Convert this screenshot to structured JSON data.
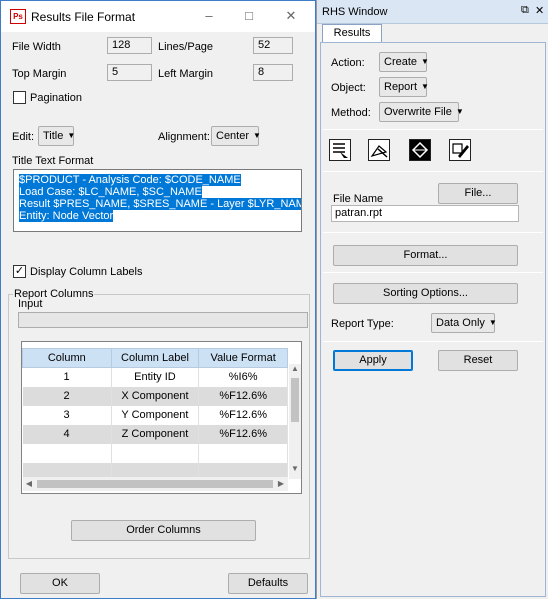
{
  "dialog": {
    "title": "Results File Format",
    "icon_text": "Ps",
    "file_width_label": "File Width",
    "file_width_value": "128",
    "lines_page_label": "Lines/Page",
    "lines_page_value": "52",
    "top_margin_label": "Top Margin",
    "top_margin_value": "5",
    "left_margin_label": "Left Margin",
    "left_margin_value": "8",
    "pagination_label": "Pagination",
    "pagination_checked": false,
    "edit_label": "Edit:",
    "edit_value": "Title",
    "alignment_label": "Alignment:",
    "alignment_value": "Center",
    "title_format_label": "Title Text Format",
    "title_lines": [
      "$PRODUCT - Analysis Code: $CODE_NAME",
      "Load Case: $LC_NAME, $SC_NAME",
      "Result $PRES_NAME, $SRES_NAME - Layer $LYR_NAME",
      "Entity: Node Vector"
    ],
    "display_column_labels": "Display Column Labels",
    "display_column_checked": true,
    "report_columns_label": "Report Columns",
    "input_label": "Input",
    "input_value": "",
    "columns_header": [
      "Column",
      "Column Label",
      "Value Format"
    ],
    "rows": [
      [
        "1",
        "Entity ID",
        "%I6%"
      ],
      [
        "2",
        "X Component",
        "%F12.6%"
      ],
      [
        "3",
        "Y Component",
        "%F12.6%"
      ],
      [
        "4",
        "Z Component",
        "%F12.6%"
      ]
    ],
    "order_columns_label": "Order Columns",
    "ok_label": "OK",
    "defaults_label": "Defaults"
  },
  "rhs": {
    "title": "RHS Window",
    "tab_label": "Results",
    "action_label": "Action:",
    "action_value": "Create",
    "object_label": "Object:",
    "object_value": "Report",
    "method_label": "Method:",
    "method_value": "Overwrite File",
    "file_name_label": "File Name",
    "file_name_value": "patran.rpt",
    "file_button": "File...",
    "format_button": "Format...",
    "sorting_button": "Sorting Options...",
    "report_type_label": "Report Type:",
    "report_type_value": "Data Only",
    "apply_button": "Apply",
    "reset_button": "Reset"
  },
  "colors": {
    "selection": "#0078d7",
    "header_bg": "#cde1f5",
    "title_accent": "#3d7cc9"
  }
}
